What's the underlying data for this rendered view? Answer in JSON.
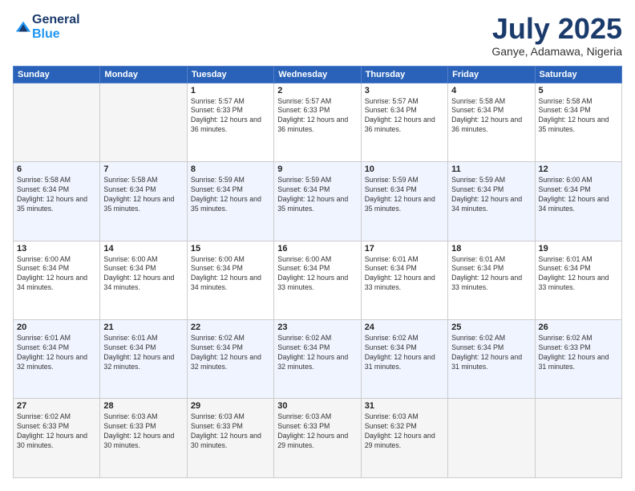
{
  "header": {
    "logo_line1": "General",
    "logo_line2": "Blue",
    "month": "July 2025",
    "location": "Ganye, Adamawa, Nigeria"
  },
  "days_of_week": [
    "Sunday",
    "Monday",
    "Tuesday",
    "Wednesday",
    "Thursday",
    "Friday",
    "Saturday"
  ],
  "weeks": [
    [
      {
        "day": "",
        "info": ""
      },
      {
        "day": "",
        "info": ""
      },
      {
        "day": "1",
        "info": "Sunrise: 5:57 AM\nSunset: 6:33 PM\nDaylight: 12 hours and 36 minutes."
      },
      {
        "day": "2",
        "info": "Sunrise: 5:57 AM\nSunset: 6:33 PM\nDaylight: 12 hours and 36 minutes."
      },
      {
        "day": "3",
        "info": "Sunrise: 5:57 AM\nSunset: 6:34 PM\nDaylight: 12 hours and 36 minutes."
      },
      {
        "day": "4",
        "info": "Sunrise: 5:58 AM\nSunset: 6:34 PM\nDaylight: 12 hours and 36 minutes."
      },
      {
        "day": "5",
        "info": "Sunrise: 5:58 AM\nSunset: 6:34 PM\nDaylight: 12 hours and 35 minutes."
      }
    ],
    [
      {
        "day": "6",
        "info": "Sunrise: 5:58 AM\nSunset: 6:34 PM\nDaylight: 12 hours and 35 minutes."
      },
      {
        "day": "7",
        "info": "Sunrise: 5:58 AM\nSunset: 6:34 PM\nDaylight: 12 hours and 35 minutes."
      },
      {
        "day": "8",
        "info": "Sunrise: 5:59 AM\nSunset: 6:34 PM\nDaylight: 12 hours and 35 minutes."
      },
      {
        "day": "9",
        "info": "Sunrise: 5:59 AM\nSunset: 6:34 PM\nDaylight: 12 hours and 35 minutes."
      },
      {
        "day": "10",
        "info": "Sunrise: 5:59 AM\nSunset: 6:34 PM\nDaylight: 12 hours and 35 minutes."
      },
      {
        "day": "11",
        "info": "Sunrise: 5:59 AM\nSunset: 6:34 PM\nDaylight: 12 hours and 34 minutes."
      },
      {
        "day": "12",
        "info": "Sunrise: 6:00 AM\nSunset: 6:34 PM\nDaylight: 12 hours and 34 minutes."
      }
    ],
    [
      {
        "day": "13",
        "info": "Sunrise: 6:00 AM\nSunset: 6:34 PM\nDaylight: 12 hours and 34 minutes."
      },
      {
        "day": "14",
        "info": "Sunrise: 6:00 AM\nSunset: 6:34 PM\nDaylight: 12 hours and 34 minutes."
      },
      {
        "day": "15",
        "info": "Sunrise: 6:00 AM\nSunset: 6:34 PM\nDaylight: 12 hours and 34 minutes."
      },
      {
        "day": "16",
        "info": "Sunrise: 6:00 AM\nSunset: 6:34 PM\nDaylight: 12 hours and 33 minutes."
      },
      {
        "day": "17",
        "info": "Sunrise: 6:01 AM\nSunset: 6:34 PM\nDaylight: 12 hours and 33 minutes."
      },
      {
        "day": "18",
        "info": "Sunrise: 6:01 AM\nSunset: 6:34 PM\nDaylight: 12 hours and 33 minutes."
      },
      {
        "day": "19",
        "info": "Sunrise: 6:01 AM\nSunset: 6:34 PM\nDaylight: 12 hours and 33 minutes."
      }
    ],
    [
      {
        "day": "20",
        "info": "Sunrise: 6:01 AM\nSunset: 6:34 PM\nDaylight: 12 hours and 32 minutes."
      },
      {
        "day": "21",
        "info": "Sunrise: 6:01 AM\nSunset: 6:34 PM\nDaylight: 12 hours and 32 minutes."
      },
      {
        "day": "22",
        "info": "Sunrise: 6:02 AM\nSunset: 6:34 PM\nDaylight: 12 hours and 32 minutes."
      },
      {
        "day": "23",
        "info": "Sunrise: 6:02 AM\nSunset: 6:34 PM\nDaylight: 12 hours and 32 minutes."
      },
      {
        "day": "24",
        "info": "Sunrise: 6:02 AM\nSunset: 6:34 PM\nDaylight: 12 hours and 31 minutes."
      },
      {
        "day": "25",
        "info": "Sunrise: 6:02 AM\nSunset: 6:34 PM\nDaylight: 12 hours and 31 minutes."
      },
      {
        "day": "26",
        "info": "Sunrise: 6:02 AM\nSunset: 6:33 PM\nDaylight: 12 hours and 31 minutes."
      }
    ],
    [
      {
        "day": "27",
        "info": "Sunrise: 6:02 AM\nSunset: 6:33 PM\nDaylight: 12 hours and 30 minutes."
      },
      {
        "day": "28",
        "info": "Sunrise: 6:03 AM\nSunset: 6:33 PM\nDaylight: 12 hours and 30 minutes."
      },
      {
        "day": "29",
        "info": "Sunrise: 6:03 AM\nSunset: 6:33 PM\nDaylight: 12 hours and 30 minutes."
      },
      {
        "day": "30",
        "info": "Sunrise: 6:03 AM\nSunset: 6:33 PM\nDaylight: 12 hours and 29 minutes."
      },
      {
        "day": "31",
        "info": "Sunrise: 6:03 AM\nSunset: 6:32 PM\nDaylight: 12 hours and 29 minutes."
      },
      {
        "day": "",
        "info": ""
      },
      {
        "day": "",
        "info": ""
      }
    ]
  ]
}
